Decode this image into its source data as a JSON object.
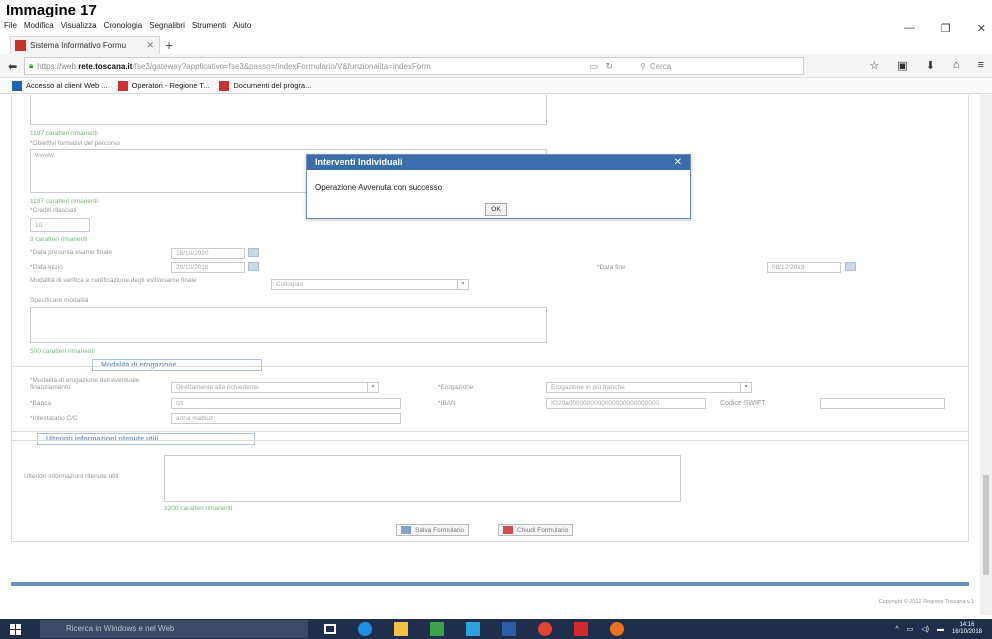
{
  "caption": "Immagine 17",
  "menu": [
    "File",
    "Modifica",
    "Visualizza",
    "Cronologia",
    "Segnalibri",
    "Strumenti",
    "Aiuto"
  ],
  "tab": {
    "title": "Sistema Informativo Formu"
  },
  "address": {
    "prefix": "https://web.",
    "host": "rete.toscana.it",
    "tail": "/fse3/gateway?applicativo=fse3&passo=/indexFormulario/V&funzionalita=indexForm",
    "search_placeholder": "Cerca"
  },
  "bookmarks": [
    "Accesso al client Web ...",
    "Operatori - Regione T...",
    "Documenti del progra..."
  ],
  "form": {
    "remaining_1": "1197 caratteri rimanenti",
    "objectives_label": "*Obiettivi formativi del percorso",
    "objectives_value": "wwww",
    "remaining_2": "1197 caratteri rimanenti",
    "credits_label": "*Crediti rilasciati",
    "credits_value": "10",
    "remaining_3": "8 caratteri rimanenti",
    "exam_date_label": "*Data presunta esame finale",
    "exam_date_value": "16/10/2020",
    "start_date_label": "*Data inizio",
    "start_date_value": "20/10/2018",
    "end_date_label": "*Data fine",
    "end_date_value": "08/12/2019",
    "verification_label": "Modalità di verifica e certificazione degli esiti/esame finale",
    "verification_value": "Colloquio",
    "specify_label": "Specificare modalità",
    "remaining_4": "500 caratteri rimanenti"
  },
  "disbursement": {
    "section_title": "Modalità di erogazione",
    "mode_label": "*Modalità di erogazione dell'eventuale finanziamento",
    "mode_value": "Direttamente alla richiedente",
    "erogazione_label": "*Erogazione",
    "erogazione_value": "Erogazione in più tranche",
    "bank_label": "*Banca",
    "bank_value": "crt",
    "iban_label": "*IBAN",
    "iban_value": "IO20a0000000000000000000000000",
    "swift_label": "Codice SWIFT",
    "holder_label": "*Intestatario C/C",
    "holder_value": "anna mattiuz"
  },
  "further": {
    "section_title": "Ulteriori informazioni ritenute utili",
    "label": "Ulteriori informazioni ritenute utili",
    "remaining": "1200 caratteri rimanenti"
  },
  "buttons": {
    "save": "Salva Formulario",
    "close": "Chiudi Formulario"
  },
  "copyright": "Copyright © 2012 Regione Toscana v.1",
  "modal": {
    "title": "Interventi Individuali",
    "message": "Operazione Avvenuta con successo",
    "ok": "OK"
  },
  "taskbar": {
    "search_placeholder": "Ricerca in Windows e nel Web",
    "time": "14:16",
    "date": "16/10/2018"
  },
  "colors": {
    "modal_header": "#3b6daa",
    "section_border": "#aac2de",
    "remaining_text": "#7cb87c"
  }
}
